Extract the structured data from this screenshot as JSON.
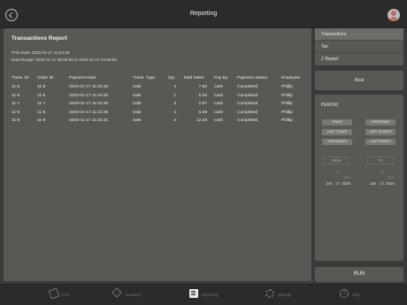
{
  "header": {
    "title": "Reporting"
  },
  "report": {
    "title": "Transactions Report",
    "print_date": "Print Date: 2020-01-17 11:24:36",
    "data_range": "Data Range: 2020-01-17 00:00:00 to 2020-01-17 23:59:59",
    "columns": [
      "Trans. ID",
      "Order ID",
      "Payment Date",
      "Trans. Type",
      "Qty",
      "Total Sales",
      "Pay By",
      "Payment Status",
      "Employee"
    ],
    "rows": [
      [
        "11-5",
        "11-5",
        "2020-01-17 11:23:45",
        "Sale",
        "4",
        "7.80",
        "cash",
        "Completed",
        "Phillip"
      ],
      [
        "11-6",
        "11-6",
        "2020-01-17 11:24:00",
        "Sale",
        "1",
        "5.30",
        "cash",
        "Completed",
        "Phillip"
      ],
      [
        "11-7",
        "11-7",
        "2020-01-17 11:24:20",
        "Sale",
        "3",
        "2.97",
        "cash",
        "Completed",
        "Phillip"
      ],
      [
        "11-8",
        "11-8",
        "2020-01-17 11:24:25",
        "Sale",
        "4",
        "5.98",
        "cash",
        "Completed",
        "Phillip"
      ],
      [
        "11-9",
        "11-9",
        "2020-01-17 11:24:31",
        "Sale",
        "3",
        "12.38",
        "cash",
        "Completed",
        "Phillip"
      ]
    ]
  },
  "side_menu": {
    "items": [
      "Transactions",
      "Tax",
      "Z Report"
    ]
  },
  "real_label": "Real",
  "period": {
    "label": "PERIOD",
    "today": "TODAY",
    "yesterday": "YESTERDAY",
    "last7": "LAST 7 DAYS",
    "last30": "LAST 30 DAYS",
    "this_month": "THIS MONTH",
    "last_month": "LAST MONTH",
    "from_label": "FROM",
    "to_label": "TO",
    "from_picker": {
      "above_day": "16",
      "above_year": "2019",
      "month": "Jan",
      "day": "17",
      "year": "2020"
    },
    "to_picker": {
      "above_day": "16",
      "above_year": "2019",
      "month": "Jan",
      "day": "17",
      "year": "2020"
    }
  },
  "run_label": "RUN",
  "tabbar": {
    "pos": "POS",
    "inventory": "Inventory",
    "reporting": "Reporting",
    "settings": "Settings",
    "help": "Help"
  },
  "colors": {
    "background": "#3b3a38",
    "panel": "#5a5855",
    "bar": "#2c2b29",
    "active_item": "#6e6c69"
  }
}
